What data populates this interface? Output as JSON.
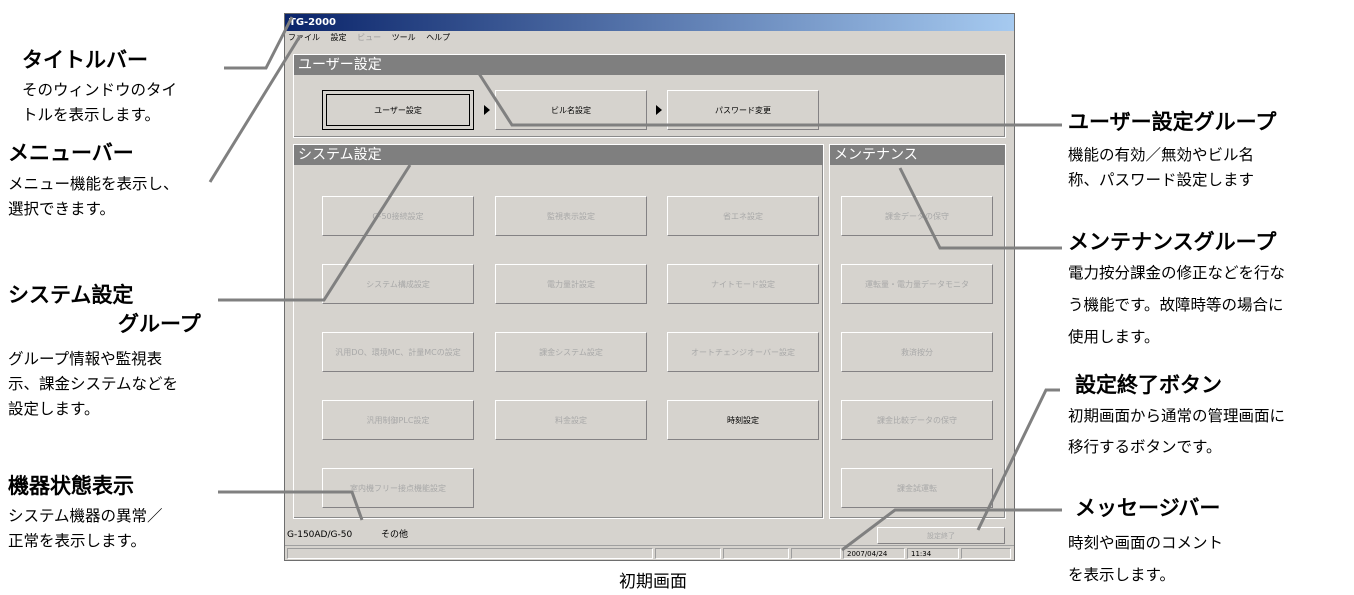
{
  "window": {
    "title": "TG-2000",
    "menu": [
      {
        "label": "ファイル",
        "enabled": true
      },
      {
        "label": "設定",
        "enabled": true
      },
      {
        "label": "ビュー",
        "enabled": false
      },
      {
        "label": "ツール",
        "enabled": true
      },
      {
        "label": "ヘルプ",
        "enabled": true
      }
    ]
  },
  "user_group": {
    "header": "ユーザー設定",
    "buttons": [
      "ユーザー設定",
      "ビル名設定",
      "パスワード変更"
    ]
  },
  "system_group": {
    "header": "システム設定",
    "buttons": [
      "G-50接続設定",
      "監視表示設定",
      "省エネ設定",
      "システム構成設定",
      "電力量計設定",
      "ナイトモード設定",
      "汎用DO、環境MC、計量MCの設定",
      "課金システム設定",
      "オートチェンジオーバー設定",
      "汎用制御PLC設定",
      "料金設定",
      "時刻設定",
      "室内機フリー接点機能設定"
    ]
  },
  "maintenance_group": {
    "header": "メンテナンス",
    "buttons": [
      "課金データの保守",
      "運転量・電力量データモニタ",
      "救済按分",
      "課金比較データの保守",
      "課金試運転"
    ]
  },
  "status": {
    "device": "G-150AD/G-50",
    "device_state": "その他",
    "finish_button": "設定終了",
    "date": "2007/04/24",
    "time": "11:34"
  },
  "annotations": {
    "titlebar": {
      "title": "タイトルバー",
      "desc1": "そのウィンドウのタイ",
      "desc2": "トルを表示します。"
    },
    "menubar": {
      "title": "メニューバー",
      "desc1": "メニュー機能を表示し、",
      "desc2": "選択できます。"
    },
    "system": {
      "title1": "システム設定",
      "title2": "グループ",
      "desc1": "グループ情報や監視表",
      "desc2": "示、課金システムなどを",
      "desc3": "設定します。"
    },
    "device": {
      "title": "機器状態表示",
      "desc1": "システム機器の異常／",
      "desc2": "正常を表示します。"
    },
    "user": {
      "title": "ユーザー設定グループ",
      "desc1": "機能の有効／無効やビル名",
      "desc2": "称、パスワード設定します"
    },
    "maint": {
      "title": "メンテナンスグループ",
      "desc1": "電力按分課金の修正などを行な",
      "desc2": "う機能です。故障時等の場合に",
      "desc3": "使用します。"
    },
    "finish": {
      "title": "設定終了ボタン",
      "desc1": "初期画面から通常の管理画面に",
      "desc2": "移行するボタンです。"
    },
    "message": {
      "title": "メッセージバー",
      "desc1": "時刻や画面のコメント",
      "desc2": "を表示します。"
    }
  },
  "caption": "初期画面"
}
